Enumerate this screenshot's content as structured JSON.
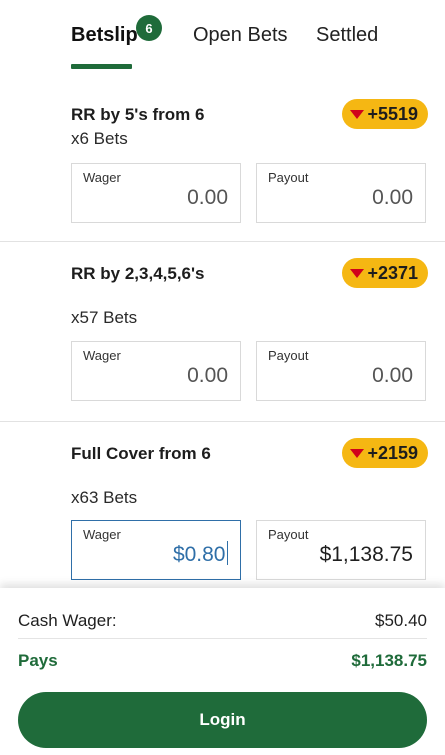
{
  "tabs": {
    "betslip": "Betslip",
    "betslip_count": "6",
    "open_bets": "Open Bets",
    "settled": "Settled"
  },
  "bets": [
    {
      "title": "RR by 5's from 6",
      "count": "x6 Bets",
      "odds": "+5519",
      "wager_label": "Wager",
      "wager_value": "0.00",
      "payout_label": "Payout",
      "payout_value": "0.00"
    },
    {
      "title": "RR by 2,3,4,5,6's",
      "count": "x57 Bets",
      "odds": "+2371",
      "wager_label": "Wager",
      "wager_value": "0.00",
      "payout_label": "Payout",
      "payout_value": "0.00"
    },
    {
      "title": "Full Cover from 6",
      "count": "x63 Bets",
      "odds": "+2159",
      "wager_label": "Wager",
      "wager_value": "$0.80",
      "payout_label": "Payout",
      "payout_value": "$1,138.75"
    }
  ],
  "footer": {
    "cash_wager_label": "Cash Wager:",
    "cash_wager_value": "$50.40",
    "pays_label": "Pays",
    "pays_value": "$1,138.75",
    "login_label": "Login"
  },
  "colors": {
    "brand_green": "#1f6b3a",
    "odds_yellow": "#f5b713",
    "odds_down_red": "#d0021b",
    "focus_blue": "#2f6fa8"
  }
}
